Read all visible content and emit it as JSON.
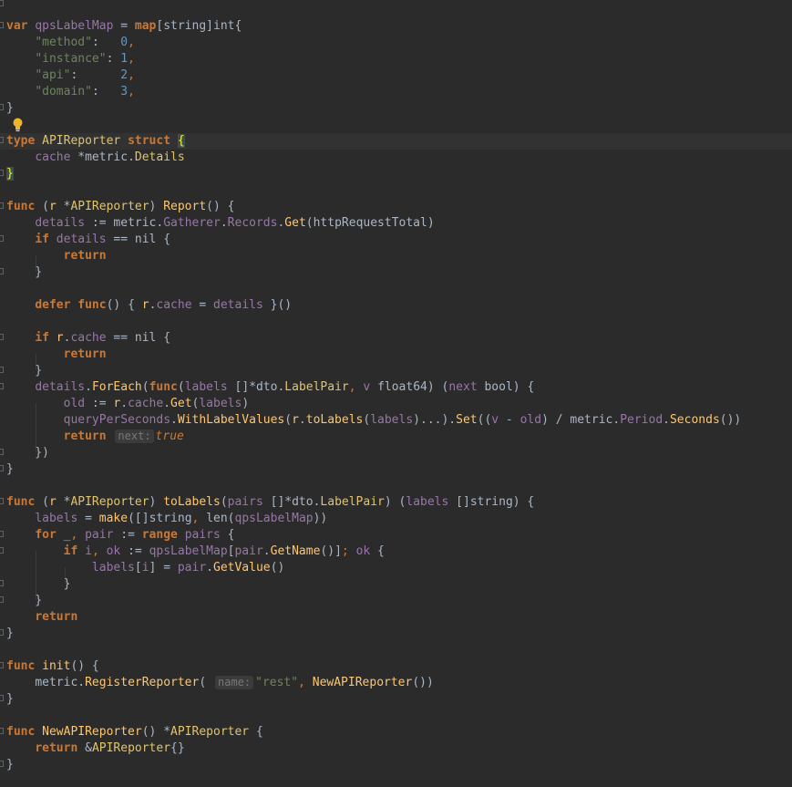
{
  "editor": {
    "language": "go",
    "colors": {
      "background": "#2b2b2b",
      "keyword": "#cc7832",
      "string": "#6a8759",
      "number": "#6897bb",
      "function": "#ffc66d",
      "field": "#9876aa",
      "text": "#a9b7c6",
      "hint": "#787878"
    },
    "icons": {
      "intention": "lightbulb-icon",
      "fold": "fold-marker-icon"
    },
    "lines": [
      {
        "text": ""
      },
      {
        "text": "var qpsLabelMap = map[string]int{"
      },
      {
        "text": "    \"method\":   0,"
      },
      {
        "text": "    \"instance\": 1,"
      },
      {
        "text": "    \"api\":      2,"
      },
      {
        "text": "    \"domain\":   3,"
      },
      {
        "text": "}"
      },
      {
        "text": ""
      },
      {
        "text": "type APIReporter struct {"
      },
      {
        "text": "    cache *metric.Details"
      },
      {
        "text": "}"
      },
      {
        "text": ""
      },
      {
        "text": "func (r *APIReporter) Report() {"
      },
      {
        "text": "    details := metric.Gatherer.Records.Get(httpRequestTotal)"
      },
      {
        "text": "    if details == nil {"
      },
      {
        "text": "        return"
      },
      {
        "text": "    }"
      },
      {
        "text": ""
      },
      {
        "text": "    defer func() { r.cache = details }()"
      },
      {
        "text": ""
      },
      {
        "text": "    if r.cache == nil {"
      },
      {
        "text": "        return"
      },
      {
        "text": "    }"
      },
      {
        "text": "    details.ForEach(func(labels []*dto.LabelPair, v float64) (next bool) {"
      },
      {
        "text": "        old := r.cache.Get(labels)"
      },
      {
        "text": "        queryPerSeconds.WithLabelValues(r.toLabels(labels)...).Set((v - old) / metric.Period.Seconds())"
      },
      {
        "text": "        return next: true"
      },
      {
        "text": "    })"
      },
      {
        "text": "}"
      },
      {
        "text": ""
      },
      {
        "text": "func (r *APIReporter) toLabels(pairs []*dto.LabelPair) (labels []string) {"
      },
      {
        "text": "    labels = make([]string, len(qpsLabelMap))"
      },
      {
        "text": "    for _, pair := range pairs {"
      },
      {
        "text": "        if i, ok := qpsLabelMap[pair.GetName()]; ok {"
      },
      {
        "text": "            labels[i] = pair.GetValue()"
      },
      {
        "text": "        }"
      },
      {
        "text": "    }"
      },
      {
        "text": "    return"
      },
      {
        "text": "}"
      },
      {
        "text": ""
      },
      {
        "text": "func init() {"
      },
      {
        "text": "    metric.RegisterReporter( name: \"rest\", NewAPIReporter())"
      },
      {
        "text": "}"
      },
      {
        "text": ""
      },
      {
        "text": "func NewAPIReporter() *APIReporter {"
      },
      {
        "text": "    return &APIReporter{}"
      },
      {
        "text": "}"
      }
    ],
    "hints": {
      "next": "next:",
      "name": "name:"
    }
  }
}
